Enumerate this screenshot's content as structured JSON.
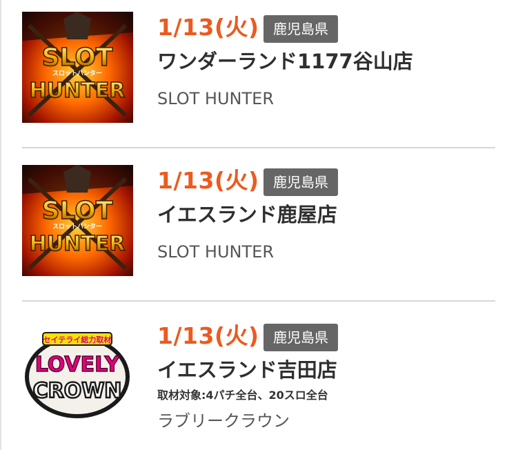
{
  "entries": [
    {
      "date": "1/13(火)",
      "prefecture": "鹿児島県",
      "store": "ワンダーランド1177谷山店",
      "subtitle": "SLOT HUNTER",
      "note": "",
      "thumb": {
        "line1": "SLOT",
        "line2": "HUNTER",
        "small": "スロットハンター",
        "kind": "slot-hunter-logo"
      }
    },
    {
      "date": "1/13(火)",
      "prefecture": "鹿児島県",
      "store": "イエスランド鹿屋店",
      "subtitle": "SLOT HUNTER",
      "note": "",
      "thumb": {
        "line1": "SLOT",
        "line2": "HUNTER",
        "small": "スロットハンター",
        "kind": "slot-hunter-logo"
      }
    },
    {
      "date": "1/13(火)",
      "prefecture": "鹿児島県",
      "store": "イエスランド吉田店",
      "subtitle": "ラブリークラウン",
      "note": "取材対象:4パチ全台、20スロ全台",
      "thumb": {
        "line1": "LOVELY",
        "line2": "CROWN",
        "small": "セイテライ総力取材",
        "kind": "lovely-crown-logo"
      }
    }
  ],
  "colors": {
    "date": "#ec5a1f",
    "badge_bg": "#666666",
    "store_text": "#2f2f2f",
    "subtitle_text": "#555555",
    "divider": "#d6d6d6"
  }
}
